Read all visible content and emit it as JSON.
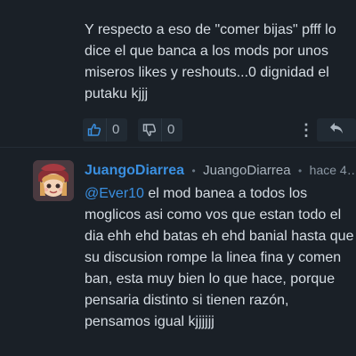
{
  "post": {
    "text": "Y respecto a eso de \"comer bijas\" pfff lo dice el que banca a los mods por unos miseros likes y reshouts...0 dignidad el putaku kjjj",
    "likes": "0",
    "dislikes": "0",
    "more_label": "⋮"
  },
  "comment": {
    "author_name": "JuangoDiarrea",
    "separator": "•",
    "author_handle": "JuangoDiarrea",
    "timestamp": "hace 4…",
    "mention": "@Ever10",
    "text": " el mod banea a todos los moglicos asi como vos que estan todo el dia ehh ehd batas eh ehd banial hasta que su discusion rompe la linea fina y comen ban, esta muy bien lo que hace, porque pensaria distinto si tienen razón, pensamos igual kjjjjjj"
  },
  "colors": {
    "background": "#1a2027",
    "accent": "#3a8fe0",
    "button_bg": "#212a33"
  },
  "icons": {
    "like": "thumbs-up-icon",
    "dislike": "thumbs-down-icon",
    "more": "more-vertical-icon",
    "reply": "reply-arrow-icon"
  }
}
